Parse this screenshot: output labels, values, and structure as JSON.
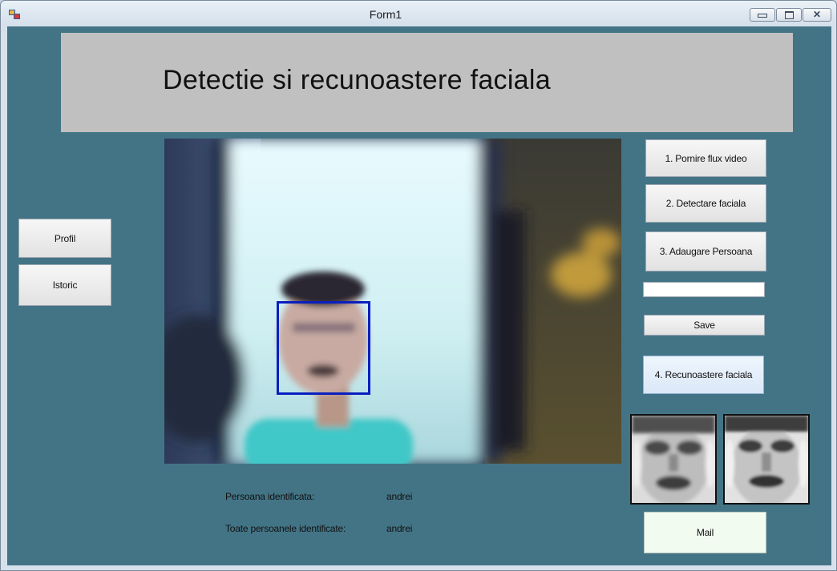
{
  "window": {
    "title": "Form1"
  },
  "header": {
    "title": "Detectie si recunoastere faciala"
  },
  "left_buttons": {
    "profile": "Profil",
    "history": "Istoric"
  },
  "right_buttons": {
    "start_video": "1. Pornire flux video",
    "detect_face": "2. Detectare faciala",
    "add_person": "3. Adaugare Persoana",
    "save": "Save",
    "recognize": "4. Recunoastere faciala",
    "mail": "Mail"
  },
  "name_input": {
    "value": ""
  },
  "results": {
    "identified_label": "Persoana identificata:",
    "identified_value": "andrei",
    "all_label": "Toate persoanele identificate:",
    "all_value": "andrei"
  },
  "colors": {
    "client_background": "#437486",
    "header_panel": "#c0c0c0",
    "detection_box": "#0a1fbf"
  },
  "icons": {
    "app": "windows-form-icon",
    "minimize": "minimize-icon",
    "maximize": "maximize-icon",
    "close": "close-icon"
  }
}
